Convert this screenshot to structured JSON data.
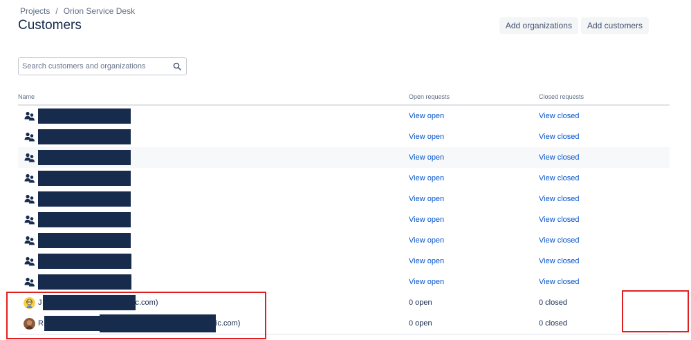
{
  "breadcrumb": {
    "projects": "Projects",
    "separator": "/",
    "project": "Orion Service Desk"
  },
  "page": {
    "title": "Customers"
  },
  "actions": {
    "add_organizations": "Add organizations",
    "add_customers": "Add customers"
  },
  "search": {
    "placeholder": "Search customers and organizations",
    "icon": "search-icon"
  },
  "table": {
    "headers": {
      "name": "Name",
      "open": "Open requests",
      "closed": "Closed requests"
    },
    "org_rows": [
      {
        "open": "View open",
        "closed": "View closed"
      },
      {
        "open": "View open",
        "closed": "View closed"
      },
      {
        "open": "View open",
        "closed": "View closed"
      },
      {
        "open": "View open",
        "closed": "View closed"
      },
      {
        "open": "View open",
        "closed": "View closed"
      },
      {
        "open": "View open",
        "closed": "View closed"
      },
      {
        "open": "View open",
        "closed": "View closed"
      },
      {
        "open": "View open",
        "closed": "View closed"
      },
      {
        "open": "View open",
        "closed": "View closed"
      }
    ],
    "customer_rows": [
      {
        "prefix": "J",
        "suffix": "c.com)",
        "open": "0 open",
        "closed": "0 closed"
      },
      {
        "prefix": "R",
        "suffix": "ic.com)",
        "open": "0 open",
        "closed": "0 closed"
      }
    ]
  },
  "colors": {
    "accent": "#0052cc",
    "redaction": "#172b4d",
    "highlight": "#e02020"
  }
}
